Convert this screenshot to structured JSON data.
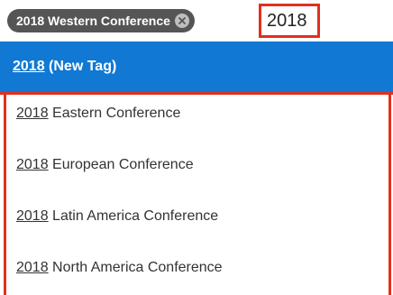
{
  "tag_input": {
    "selected_tags": [
      {
        "label": "2018 Western Conference",
        "remove_icon": "close-circle-icon"
      }
    ],
    "input_value": "2018"
  },
  "dropdown": {
    "new_tag": {
      "match": "2018",
      "suffix": " (New Tag)"
    },
    "options": [
      {
        "match": "2018",
        "rest": " Eastern Conference"
      },
      {
        "match": "2018",
        "rest": " European Conference"
      },
      {
        "match": "2018",
        "rest": " Latin America Conference"
      },
      {
        "match": "2018",
        "rest": " North America Conference"
      }
    ]
  },
  "colors": {
    "tag_pill": "#555555",
    "highlight": "#1179d3",
    "annotation_box": "#e0301e"
  }
}
